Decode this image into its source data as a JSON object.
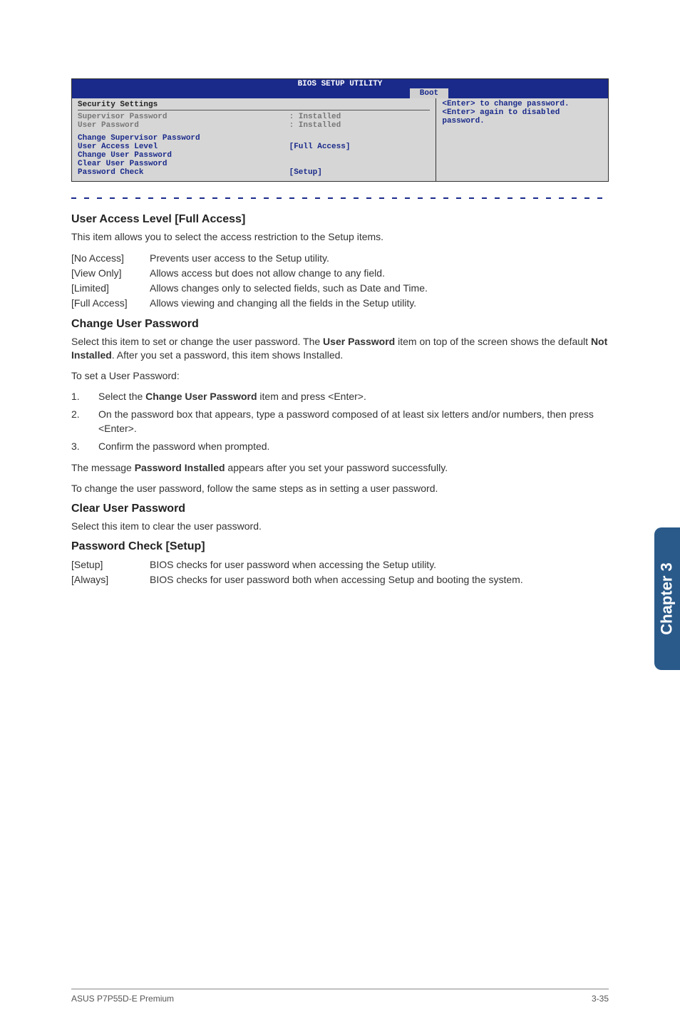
{
  "bios": {
    "title": "BIOS SETUP UTILITY",
    "tab": "Boot",
    "section_title": "Security Settings",
    "help": "<Enter> to change password.\n<Enter> again to disabled password.",
    "rows": {
      "supervisor_label": "Supervisor Password",
      "supervisor_value": ": Installed",
      "user_label": "User Password",
      "user_value": ": Installed",
      "change_supervisor": "Change Supervisor Password",
      "ual_label": "User Access Level",
      "ual_value": "[Full Access]",
      "change_user": "Change User Password",
      "clear_user": "Clear User Password",
      "pwd_check_label": "Password Check",
      "pwd_check_value": "[Setup]"
    }
  },
  "sec_ual": {
    "heading": "User Access Level [Full Access]",
    "intro": "This item allows you to select the access restriction to the Setup items.",
    "items": [
      {
        "term": "[No Access]",
        "desc": "Prevents user access to the Setup utility."
      },
      {
        "term": "[View Only]",
        "desc": "Allows access but does not allow change to any field."
      },
      {
        "term": "[Limited]",
        "desc": "Allows changes only to selected fields, such as Date and Time."
      },
      {
        "term": "[Full Access]",
        "desc": "Allows viewing and changing all the fields in the Setup utility."
      }
    ]
  },
  "sec_cup": {
    "heading": "Change User Password",
    "p1_a": "Select this item to set or change the user password. The ",
    "p1_b": "User Password",
    "p1_c": " item on top of the screen shows the default ",
    "p1_d": "Not Installed",
    "p1_e": ". After you set a password, this item shows Installed.",
    "p2": "To set a User Password:",
    "steps": [
      {
        "num": "1.",
        "a": "Select the ",
        "b": "Change User Password",
        "c": " item and press <Enter>."
      },
      {
        "num": "2.",
        "a": "On the password box that appears, type a password composed of at least six letters and/or numbers, then press <Enter>.",
        "b": "",
        "c": ""
      },
      {
        "num": "3.",
        "a": "Confirm the password when prompted.",
        "b": "",
        "c": ""
      }
    ],
    "p3_a": "The message ",
    "p3_b": "Password Installed",
    "p3_c": " appears after you set your password successfully.",
    "p4": "To change the user password, follow the same steps as in setting a user password."
  },
  "sec_clp": {
    "heading": "Clear User Password",
    "p": "Select this item to clear the user password."
  },
  "sec_pwc": {
    "heading": "Password Check [Setup]",
    "items": [
      {
        "term": "[Setup]",
        "desc": "BIOS checks for user password when accessing the Setup utility."
      },
      {
        "term": "[Always]",
        "desc": "BIOS checks for user password both when accessing Setup and booting the system."
      }
    ]
  },
  "side_tab": "Chapter 3",
  "footer": {
    "left": "ASUS P7P55D-E Premium",
    "right": "3-35"
  }
}
